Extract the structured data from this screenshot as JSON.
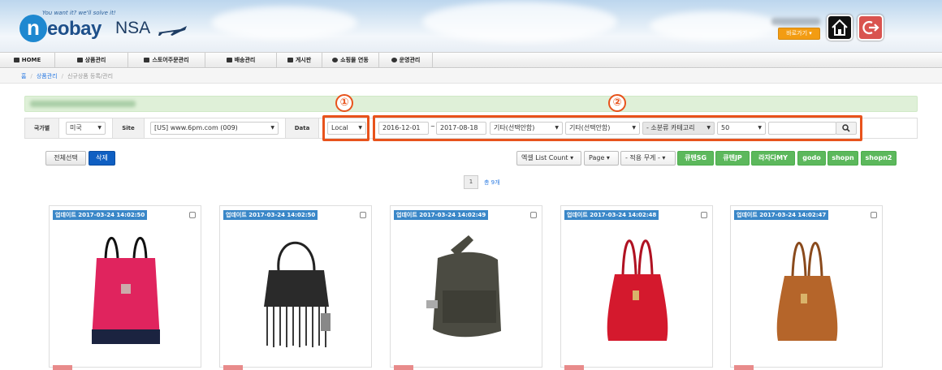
{
  "header": {
    "logo_tagline": "You want it?  we'll solve it!",
    "logo_word": "eobay",
    "logo_letter": "n",
    "logo_nsa": "NSA",
    "go_button": "바로가기 ▾"
  },
  "nav": [
    {
      "label": "HOME",
      "icon": "home-icon"
    },
    {
      "label": "상품관리",
      "icon": "gift-icon"
    },
    {
      "label": "스토어주문관리",
      "icon": "store-icon"
    },
    {
      "label": "배송관리",
      "icon": "truck-icon"
    },
    {
      "label": "게시판",
      "icon": "comments-icon"
    },
    {
      "label": "쇼핑몰 연동",
      "icon": "refresh-icon"
    },
    {
      "label": "운영관리",
      "icon": "user-icon"
    }
  ],
  "breadcrumb": [
    "홈",
    "상품관리",
    "신규상품 등록/관리"
  ],
  "filter": {
    "country_label": "국가별",
    "country_value": "미국",
    "site_label": "Site",
    "site_value": "[US] www.6pm.com (009)",
    "data_label": "Data",
    "data_value": "Local",
    "date_from": "2016-12-01",
    "date_sep": "~",
    "date_to": "2017-08-18",
    "option1": "기타(선택안함)",
    "option2": "기타(선택안함)",
    "subcategory": "- 소분류 카테고리",
    "count": "50",
    "search_value": ""
  },
  "annotations": {
    "one": "①",
    "two": "②"
  },
  "actions": {
    "select_all": "전체선택",
    "delete": "삭제",
    "excel": "엑셀 List Count",
    "page": "Page",
    "weight": "- 적용 무게 -",
    "platforms": [
      "큐텐SG",
      "큐텐JP",
      "라자다MY",
      "godo",
      "shopn",
      "shopn2"
    ]
  },
  "pagination": {
    "current": "1",
    "total": "총 9개"
  },
  "products": [
    {
      "updated": "업데이트 2017-03-24 14:02:50"
    },
    {
      "updated": "업데이트 2017-03-24 14:02:50"
    },
    {
      "updated": "업데이트 2017-03-24 14:02:49"
    },
    {
      "updated": "업데이트 2017-03-24 14:02:48"
    },
    {
      "updated": "업데이트 2017-03-24 14:02:47"
    }
  ],
  "colors": {
    "accent": "#e8531c",
    "primary": "#0f5fc2",
    "green": "#5cb85c",
    "badge": "#3a87c8"
  }
}
